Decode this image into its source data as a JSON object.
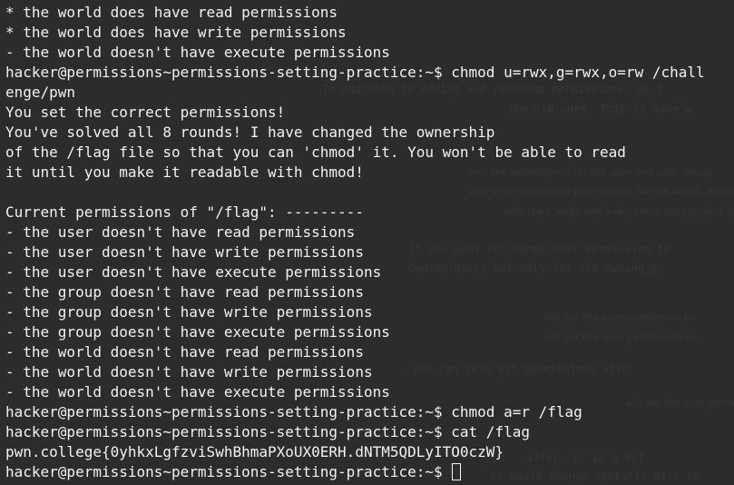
{
  "terminal": {
    "lines": [
      "* the world does have read permissions",
      "* the world does have write permissions",
      "- the world doesn't have execute permissions",
      "hacker@permissions~permissions-setting-practice:~$ chmod u=rwx,g=rwx,o=rw /chall",
      "enge/pwn",
      "You set the correct permissions!",
      "You've solved all 8 rounds! I have changed the ownership",
      "of the /flag file so that you can 'chmod' it. You won't be able to read",
      "it until you make it readable with chmod!",
      "",
      "Current permissions of \"/flag\": ---------",
      "- the user doesn't have read permissions",
      "- the user doesn't have write permissions",
      "- the user doesn't have execute permissions",
      "- the group doesn't have read permissions",
      "- the group doesn't have write permissions",
      "- the group doesn't have execute permissions",
      "- the world doesn't have read permissions",
      "- the world doesn't have write permissions",
      "- the world doesn't have execute permissions",
      "hacker@permissions~permissions-setting-practice:~$ chmod a=r /flag",
      "hacker@permissions~permissions-setting-practice:~$ cat /flag",
      "pwn.college{0yhkxLgfzviSwhBhmaPXoUX0ERH.dNTM5QDLyITO0czW}",
      "hacker@permissions~permissions-setting-practice:~$ "
    ],
    "cursor_line_index": 23,
    "background_color": "#2c2c2c",
    "text_color": "#f2f2f2"
  }
}
